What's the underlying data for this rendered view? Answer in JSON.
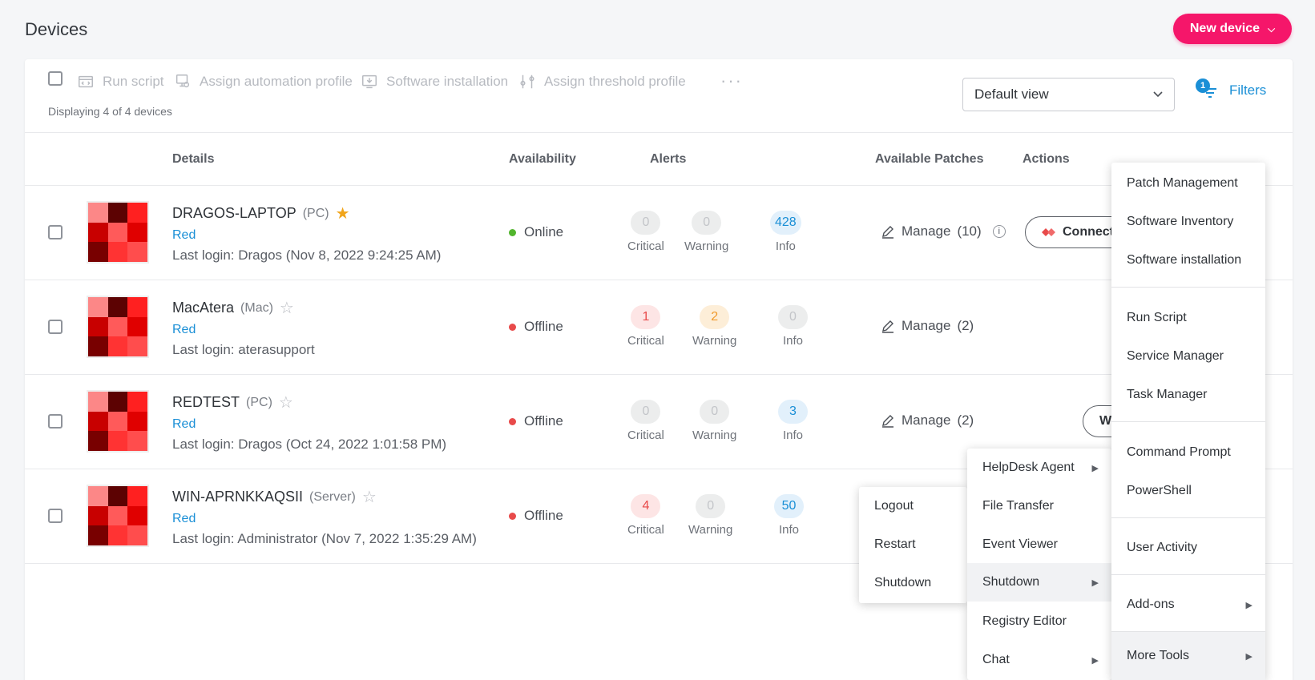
{
  "page": {
    "title": "Devices"
  },
  "header": {
    "new_device_label": "New device",
    "new_device_chevron": "⌄"
  },
  "toolbar": {
    "actions": [
      {
        "label": "Run script",
        "icon": "script-icon"
      },
      {
        "label": "Assign automation profile",
        "icon": "automation-profile-icon"
      },
      {
        "label": "Software installation",
        "icon": "software-install-icon"
      },
      {
        "label": "Assign threshold profile",
        "icon": "threshold-profile-icon"
      }
    ],
    "more": "···",
    "display_count": "Displaying 4 of 4 devices",
    "view": "Default view",
    "filters": {
      "label": "Filters",
      "badge": "1"
    }
  },
  "table": {
    "headers": {
      "details": "Details",
      "availability": "Availability",
      "alerts": "Alerts",
      "patches": "Available Patches",
      "actions": "Actions"
    },
    "rows": [
      {
        "name": "DRAGOS-LAPTOP",
        "type": "(PC)",
        "favorite": true,
        "group": "Red",
        "last_login": "Last login: Dragos (Nov 8, 2022 9:24:25 AM)",
        "status": "Online",
        "status_color": "#52b52e",
        "alerts": {
          "critical": "0",
          "warning": "0",
          "info": "428"
        },
        "alert_labels": {
          "critical": "Critical",
          "warning": "Warning",
          "info": "Info"
        },
        "manage": "Manage",
        "patch_count": "(10)",
        "action_label": "Connect"
      },
      {
        "name": "MacAtera",
        "type": "(Mac)",
        "favorite": false,
        "group": "Red",
        "last_login": "Last login: aterasupport",
        "status": "Offline",
        "status_color": "#e84a4a",
        "alerts": {
          "critical": "1",
          "warning": "2",
          "info": "0"
        },
        "alert_labels": {
          "critical": "Critical",
          "warning": "Warning",
          "info": "Info"
        },
        "manage": "Manage",
        "patch_count": "(2)"
      },
      {
        "name": "REDTEST",
        "type": "(PC)",
        "favorite": false,
        "group": "Red",
        "last_login": "Last login: Dragos (Oct 24, 2022 1:01:58 PM)",
        "status": "Offline",
        "status_color": "#e84a4a",
        "alerts": {
          "critical": "0",
          "warning": "0",
          "info": "3"
        },
        "alert_labels": {
          "critical": "Critical",
          "warning": "Warning",
          "info": "Info"
        },
        "manage": "Manage",
        "patch_count": "(2)",
        "action_label": "W"
      },
      {
        "name": "WIN-APRNKKAQSII",
        "type": "(Server)",
        "favorite": false,
        "group": "Red",
        "last_login": "Last login: Administrator (Nov 7, 2022 1:35:29 AM)",
        "status": "Offline",
        "status_color": "#e84a4a",
        "alerts": {
          "critical": "4",
          "warning": "0",
          "info": "50"
        },
        "alert_labels": {
          "critical": "Critical",
          "warning": "Warning",
          "info": "Info"
        }
      }
    ]
  },
  "menus": {
    "main": {
      "items": [
        "Patch Management",
        "Software Inventory",
        "Software installation",
        "Run Script",
        "Service Manager",
        "Task Manager",
        "Command Prompt",
        "PowerShell",
        "User Activity",
        "Add-ons",
        "More Tools"
      ]
    },
    "more_tools": {
      "items": [
        "HelpDesk Agent",
        "File Transfer",
        "Event Viewer",
        "Shutdown",
        "Registry Editor",
        "Chat"
      ]
    },
    "shutdown": {
      "items": [
        "Logout",
        "Restart",
        "Shutdown"
      ]
    }
  },
  "colors": {
    "accent": "#f5166a",
    "link": "#1a8fd6",
    "online": "#52b52e",
    "offline": "#e84a4a",
    "favorite": "#f1a51b"
  }
}
